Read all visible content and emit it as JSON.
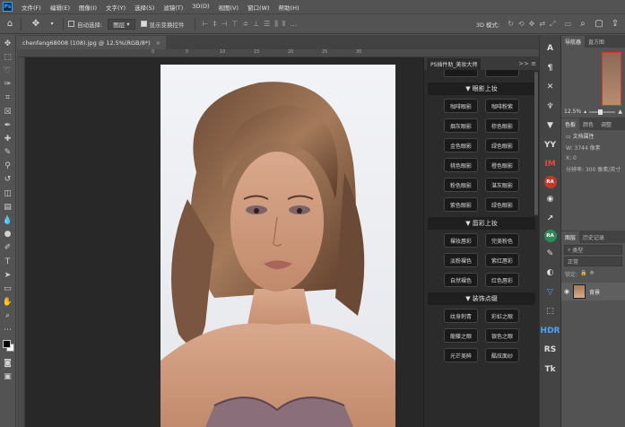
{
  "app": {
    "logo_text": "Ps"
  },
  "menu": [
    "文件(F)",
    "编辑(E)",
    "图像(I)",
    "文字(Y)",
    "选择(S)",
    "滤镜(T)",
    "3D(D)",
    "视图(V)",
    "窗口(W)",
    "帮助(H)"
  ],
  "options_bar": {
    "auto_select_label": "自动选择:",
    "auto_select_value": "图层",
    "show_transform_label": "显示变换控件",
    "mode_3d_label": "3D 模式:"
  },
  "document": {
    "tab_title": "chenfeng68008 (108).jpg @ 12.5%(RGB/8*)",
    "close_symbol": "×",
    "ruler_ticks": [
      "0",
      "5",
      "10",
      "15",
      "20",
      "25",
      "30"
    ]
  },
  "plugin": {
    "tab_label": "PS插件助_美妆大师",
    "controls": ">> ≡",
    "sections": [
      {
        "title": "▼ 眼影上妆",
        "buttons": [
          "咖啡眼影",
          "咖啡粉紫",
          "烟灰眼影",
          "棕色眼影",
          "金色眼影",
          "绿色眼影",
          "桃色眼影",
          "橙色眼影",
          "粉色眼影",
          "湛灰眼影",
          "紫色眼影",
          "绿色眼影"
        ]
      },
      {
        "title": "▼ 唇彩上妆",
        "buttons": [
          "裸妆唇彩",
          "完美粉色",
          "淡粉裸色",
          "紫红唇彩",
          "自然裸色",
          "红色唇彩"
        ]
      },
      {
        "title": "▼ 装饰点缀",
        "buttons": [
          "纹身刺青",
          "彩虹之眼",
          "龍藤之眼",
          "银色之眼",
          "光芒美眸",
          "酷炫面纱"
        ]
      }
    ]
  },
  "icon_strip": [
    {
      "label": "A",
      "icon": "character-icon",
      "style": ""
    },
    {
      "label": "¶",
      "icon": "paragraph-icon",
      "style": ""
    },
    {
      "label": "✕",
      "icon": "tools-icon",
      "style": ""
    },
    {
      "label": "♆",
      "icon": "brush-icon",
      "style": ""
    },
    {
      "label": "▼",
      "icon": "gradient-icon",
      "style": ""
    },
    {
      "label": "YY",
      "icon": "plugin-yy-icon",
      "style": ""
    },
    {
      "label": "IM",
      "icon": "plugin-im-icon",
      "style": "red-text"
    },
    {
      "label": "RA",
      "icon": "plugin-ra-icon",
      "style": "red"
    },
    {
      "label": "◉",
      "icon": "camera-icon",
      "style": ""
    },
    {
      "label": "↗",
      "icon": "arrow-icon",
      "style": ""
    },
    {
      "label": "RA",
      "icon": "plugin-ra2-icon",
      "style": "green"
    },
    {
      "label": "✎",
      "icon": "edit-icon",
      "style": ""
    },
    {
      "label": "◐",
      "icon": "color-icon",
      "style": ""
    },
    {
      "label": "▽",
      "icon": "filter-icon",
      "style": "blue"
    },
    {
      "label": "⬚",
      "icon": "frame-icon",
      "style": ""
    },
    {
      "label": "HDR",
      "icon": "hdr-icon",
      "style": "blue"
    },
    {
      "label": "RS",
      "icon": "rs-icon",
      "style": ""
    },
    {
      "label": "Tk",
      "icon": "tk-icon",
      "style": ""
    }
  ],
  "right_panel": {
    "nav_tabs": [
      "导航器",
      "直方图"
    ],
    "zoom": "12.5%",
    "color_tabs": [
      "色板",
      "颜色",
      "调整"
    ],
    "info_title": "文档属性",
    "info_lines": [
      "W: 3744 像素",
      "X: 0",
      "分辨率: 300 像素/英寸"
    ],
    "layer_tabs": [
      "图层",
      "历史记录"
    ],
    "layer_kind": "类型",
    "layer_mode": "正常",
    "lock_label": "锁定:",
    "layer_name": "背景"
  }
}
